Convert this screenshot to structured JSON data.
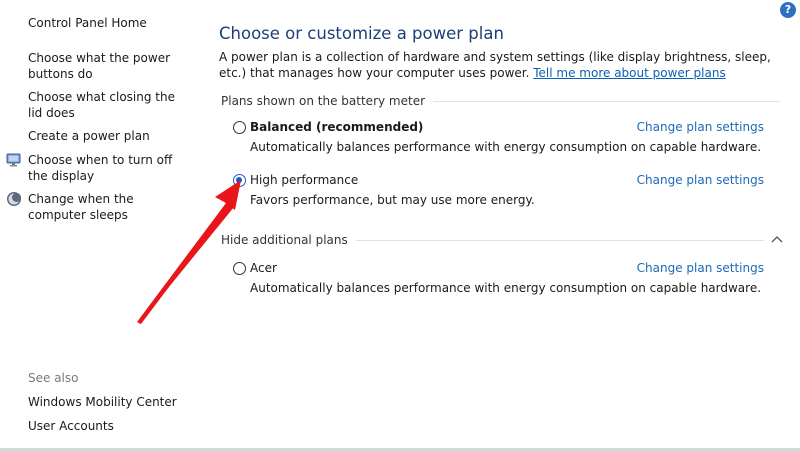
{
  "help": {
    "label": "?"
  },
  "sidebar": {
    "home": "Control Panel Home",
    "items": [
      {
        "label": "Choose what the power buttons do",
        "icon": "none"
      },
      {
        "label": "Choose what closing the lid does",
        "icon": "none"
      },
      {
        "label": "Create a power plan",
        "icon": "none"
      },
      {
        "label": "Choose when to turn off the display",
        "icon": "monitor-icon"
      },
      {
        "label": "Change when the computer sleeps",
        "icon": "moon-icon"
      }
    ],
    "see_also": {
      "heading": "See also",
      "links": [
        "Windows Mobility Center",
        "User Accounts"
      ]
    }
  },
  "main": {
    "title": "Choose or customize a power plan",
    "intro_text": "A power plan is a collection of hardware and system settings (like display brightness, sleep, etc.) that manages how your computer uses power.",
    "intro_link": "Tell me more about power plans",
    "groups": [
      {
        "header": "Plans shown on the battery meter",
        "plans": [
          {
            "name": "Balanced (recommended)",
            "description": "Automatically balances performance with energy consumption on capable hardware.",
            "change_label": "Change plan settings",
            "selected": false,
            "bold": true
          },
          {
            "name": "High performance",
            "description": "Favors performance, but may use more energy.",
            "change_label": "Change plan settings",
            "selected": true,
            "bold": false
          }
        ]
      },
      {
        "header": "Hide additional plans",
        "plans": [
          {
            "name": "Acer",
            "description": "Automatically balances performance with energy consumption on capable hardware.",
            "change_label": "Change plan settings",
            "selected": false,
            "bold": false
          }
        ]
      }
    ]
  },
  "colors": {
    "title": "#1c3f78",
    "link": "#1c6ab8",
    "radio_selected": "#1a57c9",
    "arrow": "#e8151b"
  }
}
